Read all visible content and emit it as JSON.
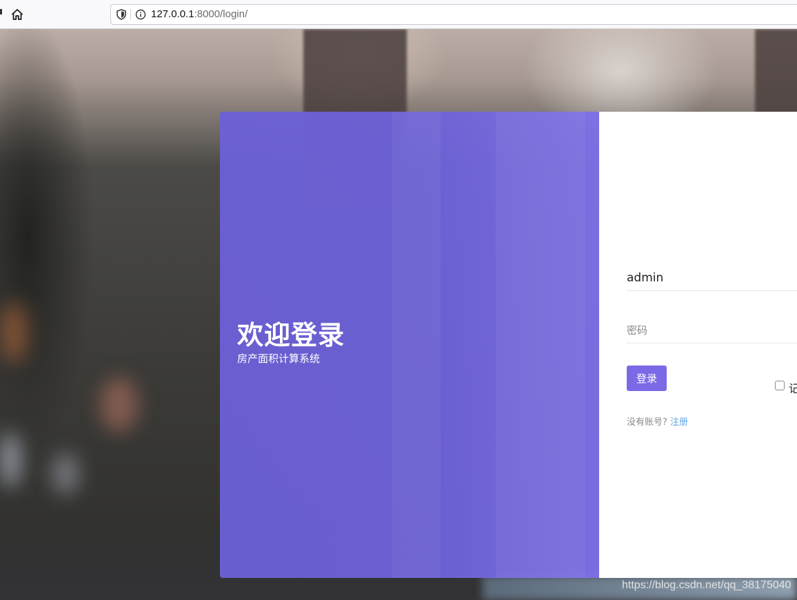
{
  "browser": {
    "url_host": "127.0.0.1",
    "url_rest": ":8000/login/"
  },
  "welcome": {
    "title": "欢迎登录",
    "subtitle": "房产面积计算系统"
  },
  "login_form": {
    "username_value": "admin",
    "password_placeholder": "密码",
    "login_button_label": "登录",
    "remember_label": "记",
    "no_account_text": "没有账号?",
    "register_link": "注册"
  },
  "watermark": "https://blog.csdn.net/qq_38175040",
  "colors": {
    "accent": "#7b6ae6",
    "link": "#5ea3e6",
    "panel": "#6f63d9"
  }
}
